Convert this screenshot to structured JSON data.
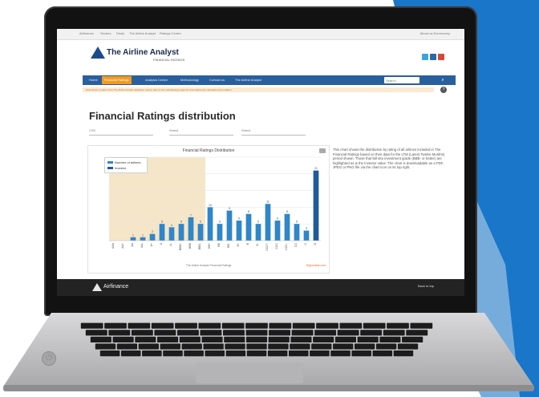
{
  "colors": {
    "backdrop_blue": "#1976c9",
    "laptop_frame": "#121212",
    "nav_blue": "#2a5f9e",
    "nav_active_orange": "#f29a1f",
    "bar_blue": "#2f86c9",
    "highlight_bg": "#f6e6c9"
  },
  "browser": {
    "tabs": [
      "Airfinance",
      "Sectors",
      "Deals",
      "The Airline Analyst",
      "Ratings Centre"
    ],
    "account_link": "About us  Euromoney"
  },
  "site": {
    "brand": "The Airline Analyst",
    "subtitle": "FINANCIAL RATINGS",
    "social_icons": [
      "twitter-icon",
      "linkedin-icon",
      "googleplus-icon"
    ],
    "nav": [
      "Home",
      "Financial Ratings",
      "Analysis Centre",
      "Methodology",
      "Contact us",
      "The Airline Analyst"
    ],
    "search_placeholder": "Search",
    "notice": "Data shown is taken from The Airline Analyst database; please refer to the methodology page for how ratings are calculated and updated"
  },
  "page": {
    "heading": "Financial Ratings distribution",
    "filters": [
      "LTM",
      "Select",
      "Select"
    ],
    "side_text": "This chart shows the distribution by rating of all airlines included in The Financial Ratings based on their data for the LTM (Latest Twelve Months) period shown. Those that fall into investment grade (BBB- or better) are highlighted as is the Investor value. The chart is downloadable as a PDF, JPEG or PNG file via the chart icon on its top right."
  },
  "chart_data": {
    "type": "bar",
    "title": "Financial Ratings Distribution",
    "legend": [
      "Number of airlines",
      "Investor"
    ],
    "legend_placement": "top-left",
    "categories": [
      "AAA",
      "AA+",
      "AA",
      "AA-",
      "A+",
      "A",
      "A-",
      "BBB+",
      "BBB",
      "BBB-",
      "BB+",
      "BB",
      "BB-",
      "B+",
      "B",
      "B-",
      "CCC+",
      "CCC",
      "CCC-",
      "CC",
      "C",
      "D"
    ],
    "values": [
      0,
      0,
      1,
      1,
      2,
      5,
      4,
      5,
      7,
      5,
      10,
      5,
      9,
      6,
      8,
      5,
      11,
      6,
      8,
      5,
      3,
      21
    ],
    "highlighted_range": [
      "AAA",
      "BBB-"
    ],
    "ylim": [
      0,
      25
    ],
    "footer": "The Airline Analyst Financial Ratings",
    "credit": "Highcharts.com"
  },
  "footer": {
    "brand": "Airfinance",
    "back_to_top": "Back to top"
  }
}
